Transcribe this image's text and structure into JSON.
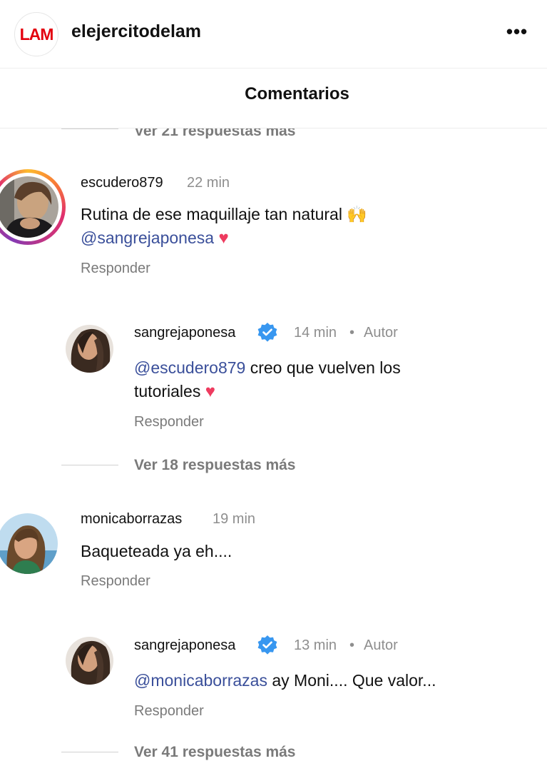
{
  "header": {
    "logo_text": "LAM",
    "account": "elejercitodelam",
    "more": "•••"
  },
  "title": "Comentarios",
  "threads": [
    {
      "view_more_above": "Ver 21 respuestas más",
      "comment": {
        "username": "escudero879",
        "time": "22 min",
        "text": "Rutina de ese maquillaje tan natural",
        "emoji": "🙌",
        "mention": "@sangrejaponesa",
        "heart": "♥",
        "reply": "Responder"
      },
      "author_reply": {
        "username": "sangrejaponesa",
        "time": "14 min",
        "dot": "•",
        "author_label": "Autor",
        "mention": "@escudero879",
        "text_a": "creo que vuelven los",
        "text_b": "tutoriales",
        "heart": "♥",
        "reply": "Responder"
      },
      "view_more": "Ver 18 respuestas más"
    },
    {
      "comment": {
        "username": "monicaborrazas",
        "time": "19 min",
        "text": "Baqueteada ya eh....",
        "reply": "Responder"
      },
      "author_reply": {
        "username": "sangrejaponesa",
        "time": "13 min",
        "dot": "•",
        "author_label": "Autor",
        "mention": "@monicaborrazas",
        "text": "ay Moni.... Que valor...",
        "reply": "Responder"
      },
      "view_more": "Ver 41 respuestas más"
    }
  ],
  "colors": {
    "brand_red": "#e3000f",
    "mention_blue": "#3a4f9a",
    "verified_blue": "#3897f0",
    "muted": "#8e8e8e"
  }
}
